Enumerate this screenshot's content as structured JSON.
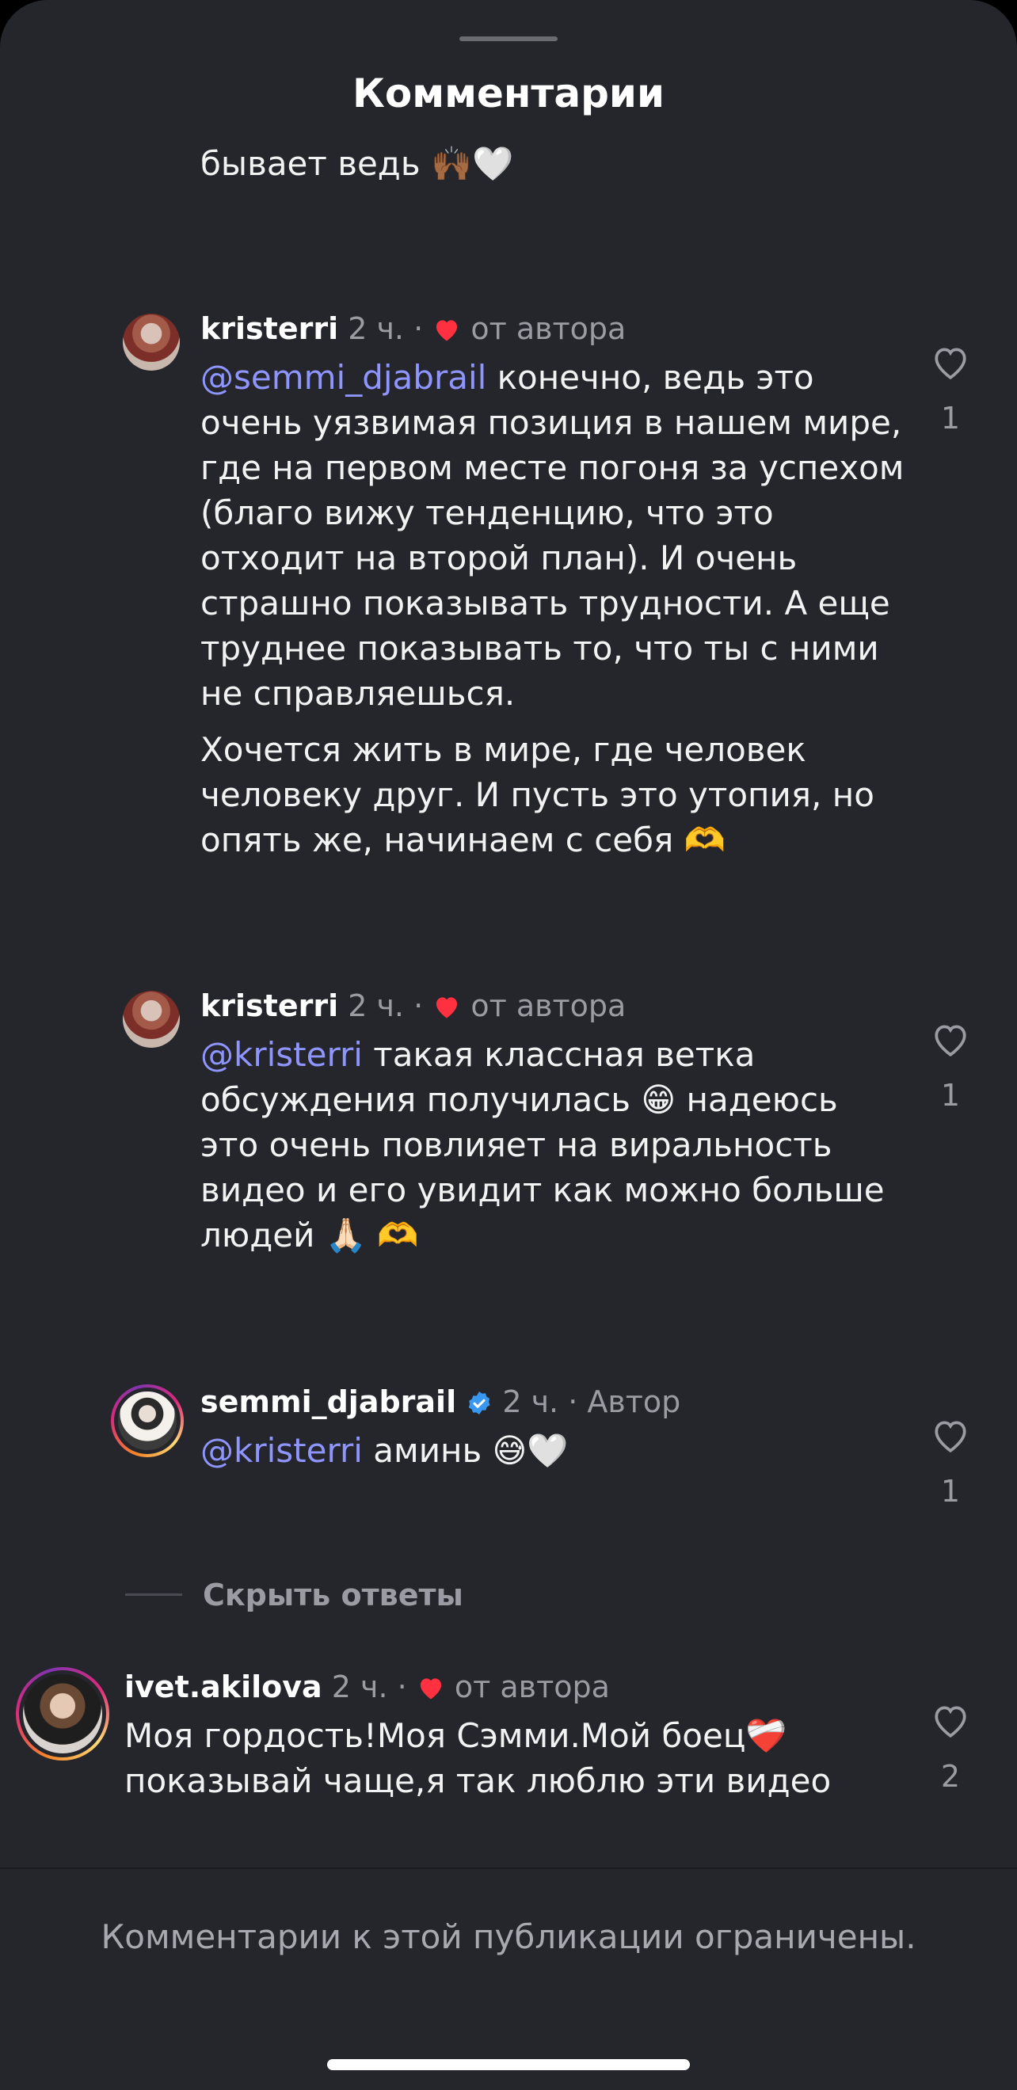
{
  "sheet": {
    "title": "Комментарии"
  },
  "previous_comment_tail": {
    "text": "бывает ведь 🙌🏾🤍"
  },
  "comments": [
    {
      "username": "kristerri",
      "time": "2 ч.",
      "separator": "·",
      "author_liked_label": "от автора",
      "mention": "@semmi_djabrail",
      "text_after_mention": " конечно, ведь это очень уязвимая позиция в нашем мире, где на первом месте погоня за успехом (благо вижу тенденцию, что это отходит на второй план). И очень страшно показывать трудности. А еще труднее показывать то, что ты с ними не справляешься.",
      "paragraph_2": "Хочется жить в мире, где человек человеку друг. И пусть это утопия, но опять же, начинаем с себя 🫶",
      "like_count": "1"
    },
    {
      "username": "kristerri",
      "time": "2 ч.",
      "separator": "·",
      "author_liked_label": "от автора",
      "mention": "@kristerri",
      "text_after_mention": " такая классная ветка обсуждения получилась 😁 надеюсь это очень повлияет на виральность видео и его увидит как можно больше людей 🙏🏻 🫶",
      "like_count": "1"
    },
    {
      "username": "semmi_djabrail",
      "verified": true,
      "time": "2 ч.",
      "separator": "·",
      "author_label": "Автор",
      "mention": "@kristerri",
      "text_after_mention": " аминь 😅🤍",
      "like_count": "1"
    }
  ],
  "hide_replies": {
    "label": "Скрыть ответы"
  },
  "top_comment": {
    "username": "ivet.akilova",
    "time": "2 ч.",
    "separator": "·",
    "author_liked_label": "от автора",
    "text": "Моя гордость!Моя Сэмми.Мой боец❤️‍🩹\nпоказывай чаще,я так люблю эти видео",
    "like_count": "2"
  },
  "footer": {
    "note": "Комментарии к этой публикации ограничены."
  },
  "colors": {
    "sheet_background": "#25262b",
    "mention": "#8f95ff",
    "heart_red": "#ff3040",
    "verified_blue": "#3897f0",
    "secondary_text": "#9b9ca3"
  },
  "icons": [
    "heart-outline-icon",
    "heart-filled-icon",
    "verified-badge-icon",
    "grabber-handle"
  ]
}
